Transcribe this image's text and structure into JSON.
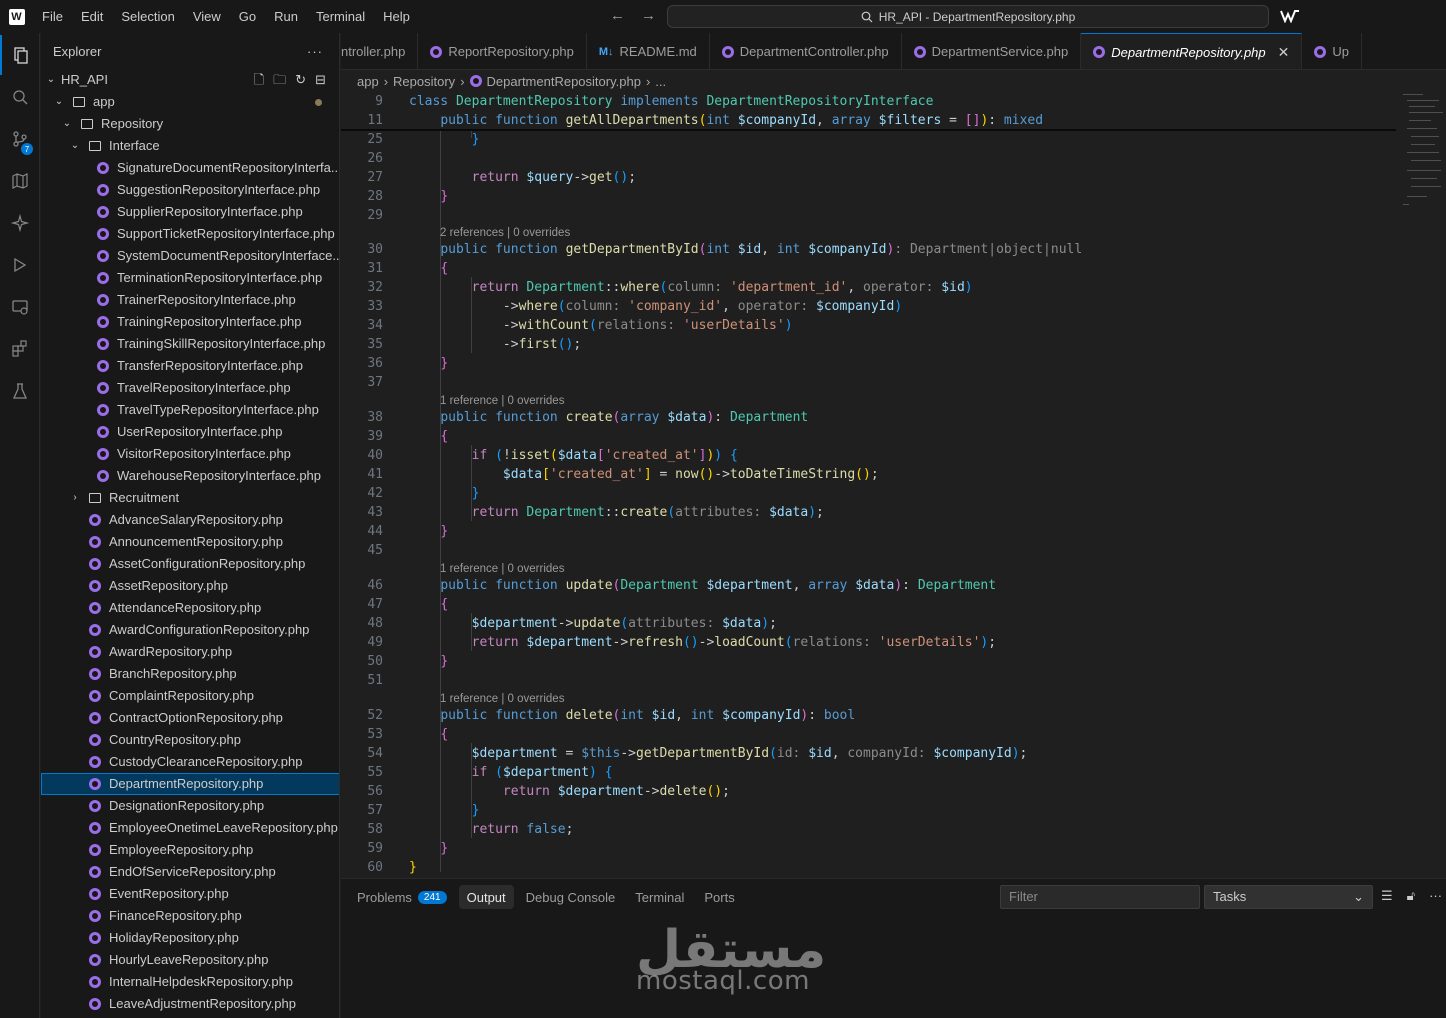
{
  "menu": [
    "File",
    "Edit",
    "Selection",
    "View",
    "Go",
    "Run",
    "Terminal",
    "Help"
  ],
  "command_center": "HR_API - DepartmentRepository.php",
  "activity_badge": "7",
  "explorer": {
    "title": "Explorer",
    "more": "···",
    "project": "HR_API",
    "folders": {
      "app": "app",
      "repository": "Repository",
      "interface": "Interface",
      "recruitment": "Recruitment"
    },
    "interface_files": [
      "SignatureDocumentRepositoryInterfa...",
      "SuggestionRepositoryInterface.php",
      "SupplierRepositoryInterface.php",
      "SupportTicketRepositoryInterface.php",
      "SystemDocumentRepositoryInterface...",
      "TerminationRepositoryInterface.php",
      "TrainerRepositoryInterface.php",
      "TrainingRepositoryInterface.php",
      "TrainingSkillRepositoryInterface.php",
      "TransferRepositoryInterface.php",
      "TravelRepositoryInterface.php",
      "TravelTypeRepositoryInterface.php",
      "UserRepositoryInterface.php",
      "VisitorRepositoryInterface.php",
      "WarehouseRepositoryInterface.php"
    ],
    "repository_files": [
      "AdvanceSalaryRepository.php",
      "AnnouncementRepository.php",
      "AssetConfigurationRepository.php",
      "AssetRepository.php",
      "AttendanceRepository.php",
      "AwardConfigurationRepository.php",
      "AwardRepository.php",
      "BranchRepository.php",
      "ComplaintRepository.php",
      "ContractOptionRepository.php",
      "CountryRepository.php",
      "CustodyClearanceRepository.php",
      "DepartmentRepository.php",
      "DesignationRepository.php",
      "EmployeeOnetimeLeaveRepository.php",
      "EmployeeRepository.php",
      "EndOfServiceRepository.php",
      "EventRepository.php",
      "FinanceRepository.php",
      "HolidayRepository.php",
      "HourlyLeaveRepository.php",
      "InternalHelpdeskRepository.php",
      "LeaveAdjustmentRepository.php"
    ],
    "selected_file": "DepartmentRepository.php"
  },
  "tabs": [
    {
      "label": "ntroller.php",
      "icon": "php"
    },
    {
      "label": "ReportRepository.php",
      "icon": "php"
    },
    {
      "label": "README.md",
      "icon": "md"
    },
    {
      "label": "DepartmentController.php",
      "icon": "php"
    },
    {
      "label": "DepartmentService.php",
      "icon": "php"
    },
    {
      "label": "DepartmentRepository.php",
      "icon": "php",
      "active": true
    },
    {
      "label": "Up",
      "icon": "php"
    }
  ],
  "breadcrumb": {
    "part1": "app",
    "part2": "Repository",
    "file": "DepartmentRepository.php",
    "tail": "..."
  },
  "editor": {
    "line_numbers": [
      "9",
      "11",
      "25",
      "26",
      "27",
      "28",
      "29",
      "30",
      "31",
      "32",
      "33",
      "34",
      "35",
      "36",
      "37",
      "38",
      "39",
      "40",
      "41",
      "42",
      "43",
      "44",
      "45",
      "46",
      "47",
      "48",
      "49",
      "50",
      "51",
      "52",
      "53",
      "54",
      "55",
      "56",
      "57",
      "58",
      "59",
      "60"
    ],
    "code_lens": [
      "2 references | 0 overrides",
      "1 reference | 0 overrides",
      "1 reference | 0 overrides",
      "1 reference | 0 overrides"
    ]
  },
  "panel": {
    "tabs": [
      "Problems",
      "Output",
      "Debug Console",
      "Terminal",
      "Ports"
    ],
    "problems_count": "241",
    "active_tab": "Output",
    "filter_placeholder": "Filter",
    "task_select": "Tasks"
  },
  "watermark": {
    "arabic": "مستقل",
    "latin": "mostaql.com"
  },
  "colors": {
    "accent": "#0078d4",
    "php_icon": "#9b6ee8",
    "selection": "#04395e"
  }
}
